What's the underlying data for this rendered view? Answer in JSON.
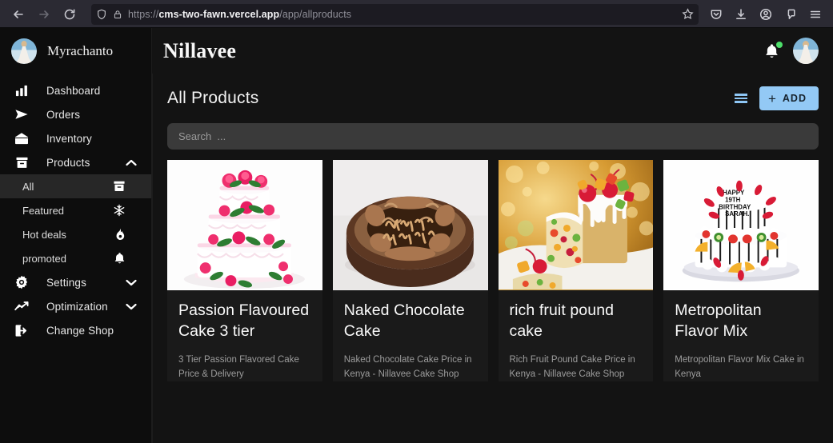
{
  "browser": {
    "url_protocol": "https://",
    "url_domain": "cms-two-fawn.vercel.app",
    "url_path": "/app/allproducts",
    "back_icon": "back-arrow-icon",
    "forward_icon": "forward-arrow-icon",
    "reload_icon": "reload-icon",
    "shield_icon": "shield-icon",
    "lock_icon": "lock-icon",
    "bookmark_icon": "star-icon",
    "pocket_icon": "pocket-icon",
    "downloads_icon": "download-icon",
    "account_icon": "account-icon",
    "extensions_icon": "extensions-icon",
    "menu_icon": "hamburger-menu-icon"
  },
  "sidebar": {
    "account_name": "Myrachanto",
    "items": [
      {
        "label": "Dashboard",
        "icon": "bar-chart-icon"
      },
      {
        "label": "Orders",
        "icon": "send-icon"
      },
      {
        "label": "Inventory",
        "icon": "open-envelope-icon"
      },
      {
        "label": "Products",
        "icon": "archive-box-icon",
        "chevron": "chevron-up-icon"
      }
    ],
    "subitems": [
      {
        "label": "All",
        "icon": "archive-box-icon",
        "active": true
      },
      {
        "label": "Featured",
        "icon": "snowflake-icon",
        "active": false
      },
      {
        "label": "Hot deals",
        "icon": "fire-icon",
        "active": false
      },
      {
        "label": "promoted",
        "icon": "bell-icon",
        "active": false
      }
    ],
    "footer_items": [
      {
        "label": "Settings",
        "icon": "gear-icon",
        "chevron": "chevron-down-icon"
      },
      {
        "label": "Optimization",
        "icon": "trending-up-icon",
        "chevron": "chevron-down-icon"
      },
      {
        "label": "Change Shop",
        "icon": "logout-icon",
        "chevron": ""
      }
    ]
  },
  "header": {
    "logo": "Nillavee",
    "bell_icon": "notification-bell-icon",
    "has_notification": true,
    "avatar_icon": "user-avatar"
  },
  "page": {
    "title": "All Products",
    "list_view_icon": "list-view-icon",
    "add_label": "ADD",
    "add_plus": "+",
    "search_placeholder": "Search  ...",
    "search_value": ""
  },
  "products": [
    {
      "title": "Passion Flavoured Cake 3 tier",
      "description": "3 Tier Passion Flavored Cake Price & Delivery",
      "image": "three-tier-white-wedding-cake-with-pink-roses"
    },
    {
      "title": "Naked Chocolate Cake",
      "description": "Naked Chocolate Cake Price in Kenya - Nillavee Cake Shop",
      "image": "round-chocolate-happy-birthday-cake"
    },
    {
      "title": "rich fruit pound cake",
      "description": "Rich Fruit Pound Cake Price in Kenya - Nillavee Cake Shop",
      "image": "fruit-pound-cake-with-candied-fruit"
    },
    {
      "title": "Metropolitan Flavor Mix",
      "description": "Metropolitan Flavor Mix Cake in Kenya",
      "image": "two-tier-fruit-topped-birthday-cake"
    }
  ],
  "colors": {
    "accent": "#93c9f5",
    "sidebar_bg": "#0d0d0d",
    "page_bg": "#131313",
    "card_bg": "#1a1a1a",
    "notification_dot": "#4ddf6a"
  }
}
